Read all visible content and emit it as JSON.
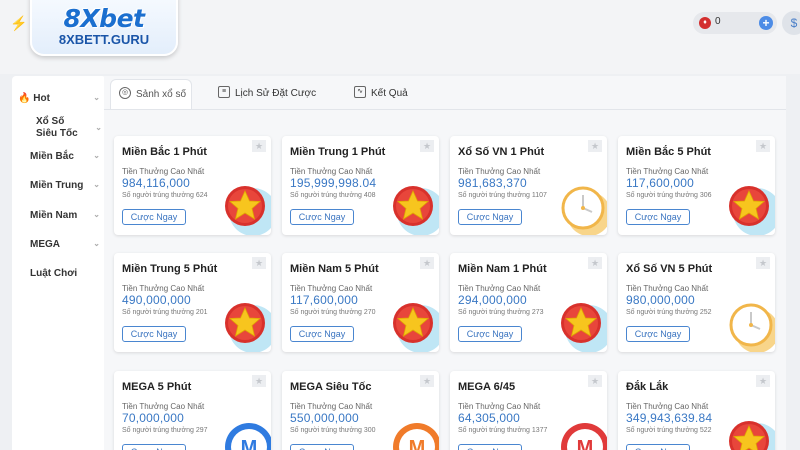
{
  "brand": {
    "logo": "8Xbet",
    "domain": "8XBETT.GURU"
  },
  "header": {
    "balance": "0"
  },
  "sidebar": {
    "items": [
      {
        "label": "Hot",
        "icon": "fire-icon"
      },
      {
        "label": "Xổ Số Siêu Tốc"
      },
      {
        "label": "Miền Bắc"
      },
      {
        "label": "Miền Trung"
      },
      {
        "label": "Miền Nam"
      },
      {
        "label": "MEGA"
      },
      {
        "label": "Luật Chơi"
      }
    ]
  },
  "tabs": [
    {
      "label": "Sảnh xổ số",
      "active": true
    },
    {
      "label": "Lịch Sử Đặt Cược"
    },
    {
      "label": "Kết Quả"
    }
  ],
  "cards": [
    {
      "title": "Miền Bắc 1 Phút",
      "label": "Tiền Thưởng Cao Nhất",
      "amount": "984,116,000",
      "winners": "Số người trúng thưởng 624",
      "button": "Cược Ngay",
      "art": "star"
    },
    {
      "title": "Miền Trung 1 Phút",
      "label": "Tiền Thưởng Cao Nhất",
      "amount": "195,999,998.04",
      "winners": "Số người trúng thưởng 408",
      "button": "Cược Ngay",
      "art": "star"
    },
    {
      "title": "Xổ Số VN 1 Phút",
      "label": "Tiền Thưởng Cao Nhất",
      "amount": "981,683,370",
      "winners": "Số người trúng thưởng 1107",
      "button": "Cược Ngay",
      "art": "clock"
    },
    {
      "title": "Miền Bắc 5 Phút",
      "label": "Tiền Thưởng Cao Nhất",
      "amount": "117,600,000",
      "winners": "Số người trúng thưởng 306",
      "button": "Cược Ngay",
      "art": "star"
    },
    {
      "title": "Miền Trung 5 Phút",
      "label": "Tiền Thưởng Cao Nhất",
      "amount": "490,000,000",
      "winners": "Số người trúng thưởng 201",
      "button": "Cược Ngay",
      "art": "star"
    },
    {
      "title": "Miền Nam 5 Phút",
      "label": "Tiền Thưởng Cao Nhất",
      "amount": "117,600,000",
      "winners": "Số người trúng thưởng 270",
      "button": "Cược Ngay",
      "art": "star"
    },
    {
      "title": "Miền Nam 1 Phút",
      "label": "Tiền Thưởng Cao Nhất",
      "amount": "294,000,000",
      "winners": "Số người trúng thưởng 273",
      "button": "Cược Ngay",
      "art": "star"
    },
    {
      "title": "Xổ Số VN 5 Phút",
      "label": "Tiền Thưởng Cao Nhất",
      "amount": "980,000,000",
      "winners": "Số người trúng thưởng 252",
      "button": "Cược Ngay",
      "art": "clock"
    },
    {
      "title": "MEGA 5 Phút",
      "label": "Tiền Thưởng Cao Nhất",
      "amount": "70,000,000",
      "winners": "Số người trúng thưởng 297",
      "button": "Cược Ngay",
      "art": "mega-blue"
    },
    {
      "title": "MEGA Siêu Tốc",
      "label": "Tiền Thưởng Cao Nhất",
      "amount": "550,000,000",
      "winners": "Số người trúng thưởng 300",
      "button": "Cược Ngay",
      "art": "mega-orange"
    },
    {
      "title": "MEGA 6/45",
      "label": "Tiền Thưởng Cao Nhất",
      "amount": "64,305,000",
      "winners": "Số người trúng thưởng 1377",
      "button": "Cược Ngay",
      "art": "mega-red"
    },
    {
      "title": "Đắk Lắk",
      "label": "Tiền Thưởng Cao Nhất",
      "amount": "349,943,639.84",
      "winners": "Số người trúng thưởng 522",
      "button": "Cược Ngay",
      "art": "star"
    }
  ]
}
